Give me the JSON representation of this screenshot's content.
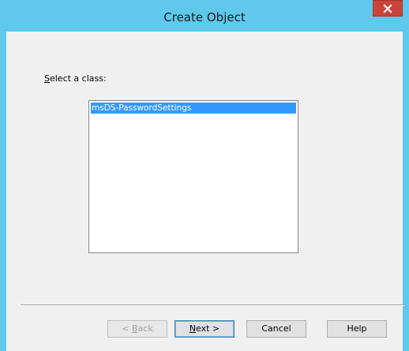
{
  "window": {
    "title": "Create Object",
    "close_icon": "close-icon"
  },
  "main": {
    "select_label_prefix": "S",
    "select_label_rest": "elect a class:",
    "classes": [
      {
        "label": "msDS-PasswordSettings",
        "selected": true
      }
    ]
  },
  "buttons": {
    "back_prefix": "< ",
    "back_mnemonic": "B",
    "back_rest": "ack",
    "next_mnemonic": "N",
    "next_rest": "ext >",
    "cancel": "Cancel",
    "help": "Help"
  },
  "colors": {
    "title_bar": "#5fc8eb",
    "close_button": "#c9453c",
    "selection": "#3399ff",
    "content_bg": "#f0f0f0"
  }
}
